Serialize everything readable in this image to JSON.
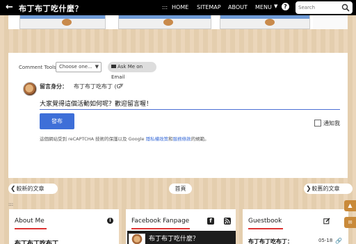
{
  "header": {
    "back_icon": "arrow-left-icon",
    "site_title": "布丁布丁吃什麼？",
    "nav_dots": ":::",
    "nav_home": "HOME",
    "nav_sitemap": "SITEMAP",
    "nav_about": "ABOUT",
    "nav_menu": "MENU",
    "search_placeholder": "Search"
  },
  "comments": {
    "tools_label": "Comment Tools:",
    "tools_selected": "Choose one...",
    "ask_email_label": "Ask Me on Email",
    "identity_label": "留言身分：",
    "identity_name": "布丁布丁吃布丁 (G",
    "input_value": "大家覺得這個活動如何呢？歡迎留言喔！",
    "publish_label": "發布",
    "notify_label": "通知我",
    "recaptcha_prefix": "這個網站受到 reCAPTCHA 技術的保護以及 Google ",
    "privacy_link": "隱私權政策",
    "and_text": "和",
    "terms_link": "服務條款",
    "recaptcha_suffix": "的規範。"
  },
  "pager": {
    "newer": "較新的文章",
    "home": "首頁",
    "older": "較舊的文章"
  },
  "footer_dots": ":::",
  "widgets": {
    "about_title": "About Me",
    "about_name": "布丁布丁吃布丁",
    "fb_title": "Facebook Fanpage",
    "fb_page_name": "布丁布丁吃什麼？",
    "guest_title": "Guestbook",
    "guest_name": "布丁布丁吃布丁：",
    "guest_date": "05-18"
  },
  "colors": {
    "topbar": "#000000",
    "accent_blue": "#3e6fd8",
    "underline_red": "#dd3333",
    "side_button": "#c98a3a"
  }
}
